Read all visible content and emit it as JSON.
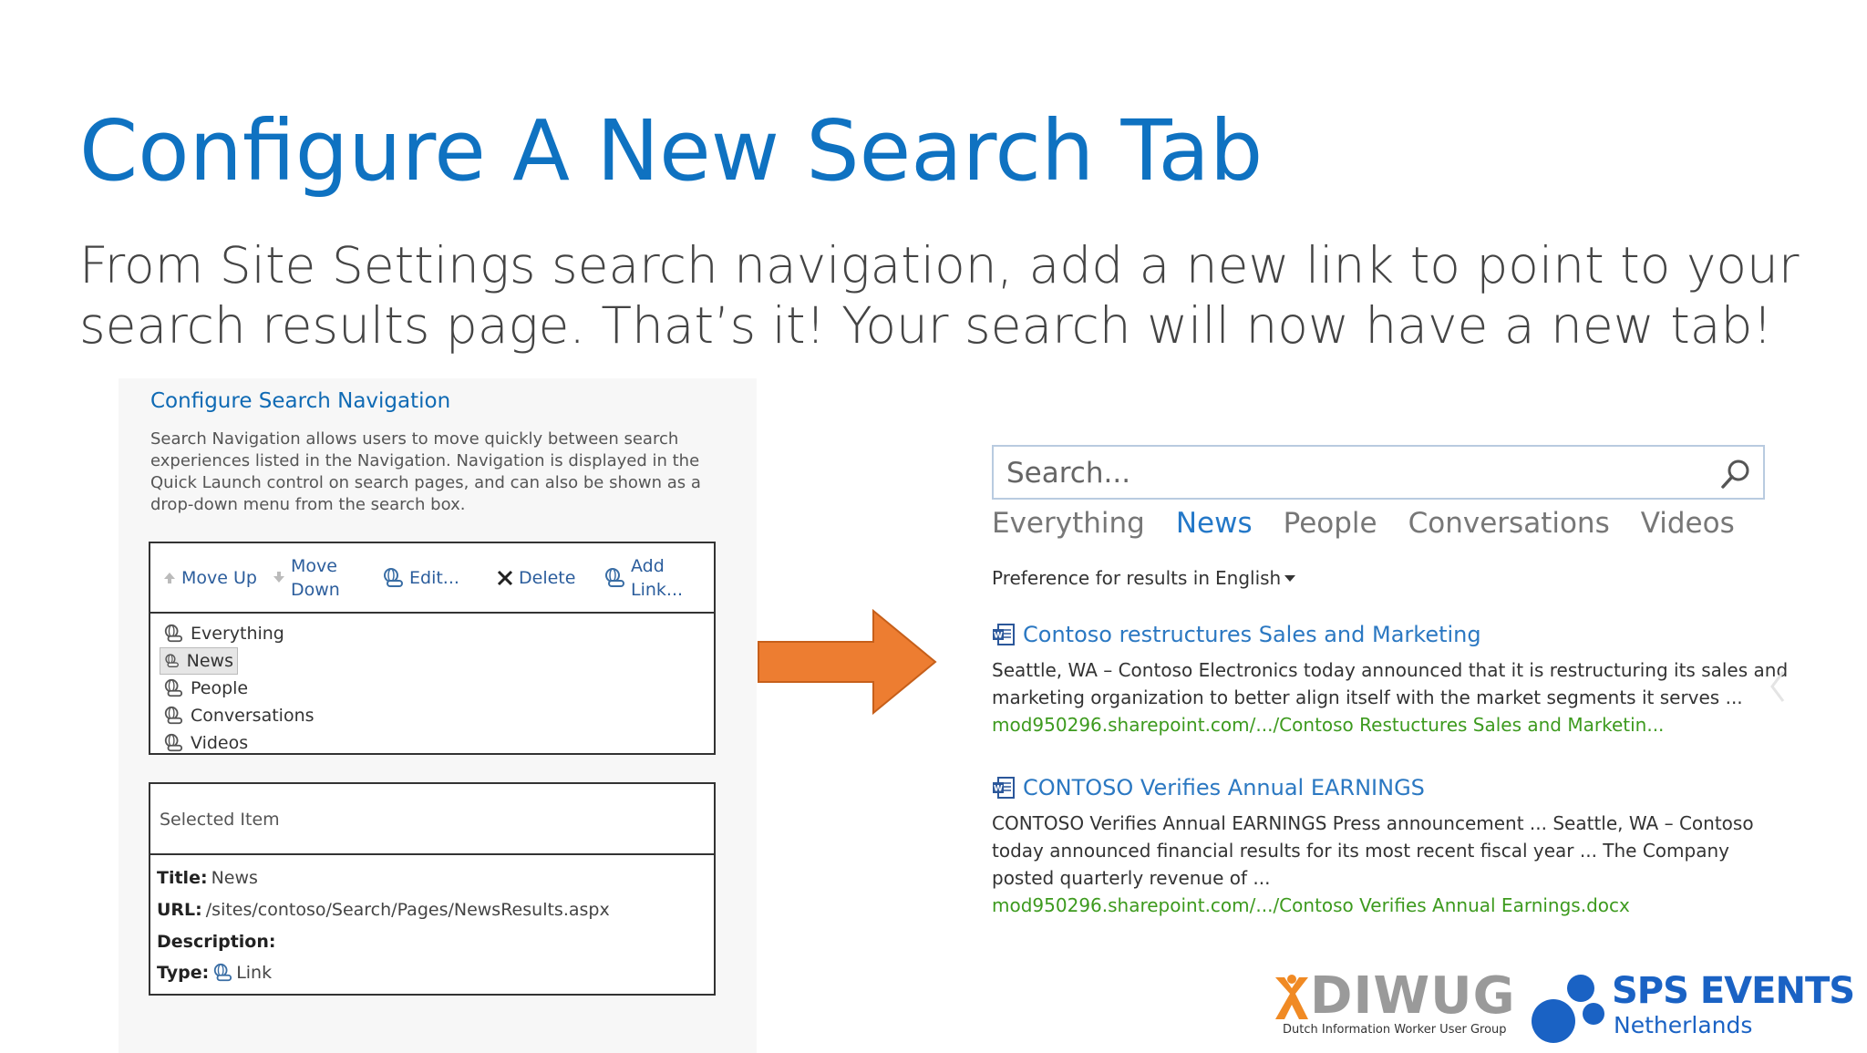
{
  "slide": {
    "title": "Configure A New Search Tab",
    "subtitle": "From Site Settings search navigation, add a new link to point to your search results page.  That’s it!  Your search will now have a new tab!"
  },
  "config": {
    "heading": "Configure Search Navigation",
    "description": "Search Navigation allows users to move quickly between search experiences listed in the Navigation. Navigation is displayed in the Quick Launch control on search pages, and can also be shown as a drop-down menu from the search box.",
    "toolbar": {
      "move_up": "Move Up",
      "move_down_1": "Move",
      "move_down_2": "Down",
      "edit": "Edit...",
      "delete": "Delete",
      "add_link_1": "Add",
      "add_link_2": "Link..."
    },
    "nav_items": [
      "Everything",
      "News",
      "People",
      "Conversations",
      "Videos"
    ],
    "selected": {
      "header": "Selected Item",
      "title_label": "Title:",
      "title_value": "News",
      "url_label": "URL:",
      "url_value": "/sites/contoso/Search/Pages/NewsResults.aspx",
      "description_label": "Description:",
      "type_label": "Type:",
      "type_value": "Link"
    }
  },
  "search": {
    "placeholder": "Search...",
    "tabs": [
      "Everything",
      "News",
      "People",
      "Conversations",
      "Videos"
    ],
    "active_tab": "News",
    "preference_prefix": "Preference for results in",
    "preference_language": "English",
    "results": [
      {
        "title": "Contoso restructures Sales and Marketing",
        "description": "Seattle, WA – Contoso Electronics today announced that it is restructuring its sales and marketing organization to better align itself with the market segments it serves ...",
        "url": "mod950296.sharepoint.com/.../Contoso Restuctures Sales and Marketin..."
      },
      {
        "title": "CONTOSO Verifies Annual EARNINGS",
        "description": "CONTOSO Verifies Annual EARNINGS Press announcement ... Seattle, WA – Contoso today announced financial results for its most recent fiscal year ... The Company posted quarterly revenue of ...",
        "url": "mod950296.sharepoint.com/.../Contoso Verifies Annual Earnings.docx"
      }
    ]
  },
  "logos": {
    "diwug": "DIWUG",
    "diwug_sub": "Dutch Information Worker User Group",
    "sps": "SPS EVENTS",
    "sps_sub": "Netherlands"
  },
  "colors": {
    "title_blue": "#0f72c1",
    "link_blue": "#2b78c2",
    "url_green": "#3d9a1e",
    "arrow_orange": "#ed7d31",
    "sps_blue": "#1a62c4",
    "diwug_orange": "#f08a24"
  }
}
